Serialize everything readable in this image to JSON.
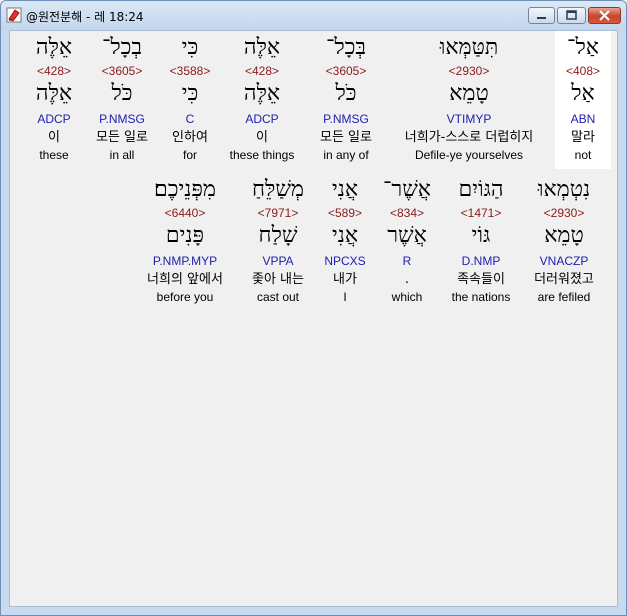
{
  "window": {
    "title": "@원전분해 - 레 18:24"
  },
  "row1": [
    {
      "hebrew": "אַל־",
      "strong": "<408>",
      "lemma": "אַל",
      "morph": "ABN",
      "korean": "말라",
      "english": "not"
    },
    {
      "hebrew": "תִּטַּמְּאוּ",
      "strong": "<2930>",
      "lemma": "טָמֵא",
      "morph": "VTIMYP",
      "korean": "너희가-스스로 더럽히지",
      "english": "Defile-ye yourselves"
    },
    {
      "hebrew": "בְּכָל־",
      "strong": "<3605>",
      "lemma": "כֹּל",
      "morph": "P.NMSG",
      "korean": "모든 일로",
      "english": "in any of"
    },
    {
      "hebrew": "אֵלֶּה",
      "strong": "<428>",
      "lemma": "אֵלֶּה",
      "morph": "ADCP",
      "korean": "이",
      "english": "these things"
    },
    {
      "hebrew": "כִּי",
      "strong": "<3588>",
      "lemma": "כִּי",
      "morph": "C",
      "korean": "인하여",
      "english": "for"
    },
    {
      "hebrew": "בְכָל־",
      "strong": "<3605>",
      "lemma": "כֹּל",
      "morph": "P.NMSG",
      "korean": "모든 일로",
      "english": "in all"
    },
    {
      "hebrew": "אֵלֶּה",
      "strong": "<428>",
      "lemma": "אֵלֶּה",
      "morph": "ADCP",
      "korean": "이",
      "english": "these"
    }
  ],
  "row2": [
    {
      "hebrew": "נִטְמְאוּ",
      "strong": "<2930>",
      "lemma": "טָמֵא",
      "morph": "VNACZP",
      "korean": "더러워졌고",
      "english": "are fefiled"
    },
    {
      "hebrew": "הַגּוֹיִם",
      "strong": "<1471>",
      "lemma": "גּוֹי",
      "morph": "D.NMP",
      "korean": "족속들이",
      "english": "the nations"
    },
    {
      "hebrew": "אֲשֶׁר־",
      "strong": "<834>",
      "lemma": "אֲשֶׁר",
      "morph": "R",
      "korean": ".",
      "english": "which"
    },
    {
      "hebrew": "אֲנִי",
      "strong": "<589>",
      "lemma": "אֲנִי",
      "morph": "NPCXS",
      "korean": "내가",
      "english": "I"
    },
    {
      "hebrew": "מְשַׁלֵּחַ",
      "strong": "<7971>",
      "lemma": "שָׁלַח",
      "morph": "VPPA",
      "korean": "좇아 내는",
      "english": "cast out"
    },
    {
      "hebrew": "מִפְּנֵיכֶם׃",
      "strong": "<6440>",
      "lemma": "פָּנִים",
      "morph": "P.NMP.MYP",
      "korean": "너희의 앞에서",
      "english": "before you"
    }
  ],
  "colors": {
    "strong": "#8b1a1a",
    "morph": "#2020b0",
    "selected_bg": "#ffffff"
  }
}
